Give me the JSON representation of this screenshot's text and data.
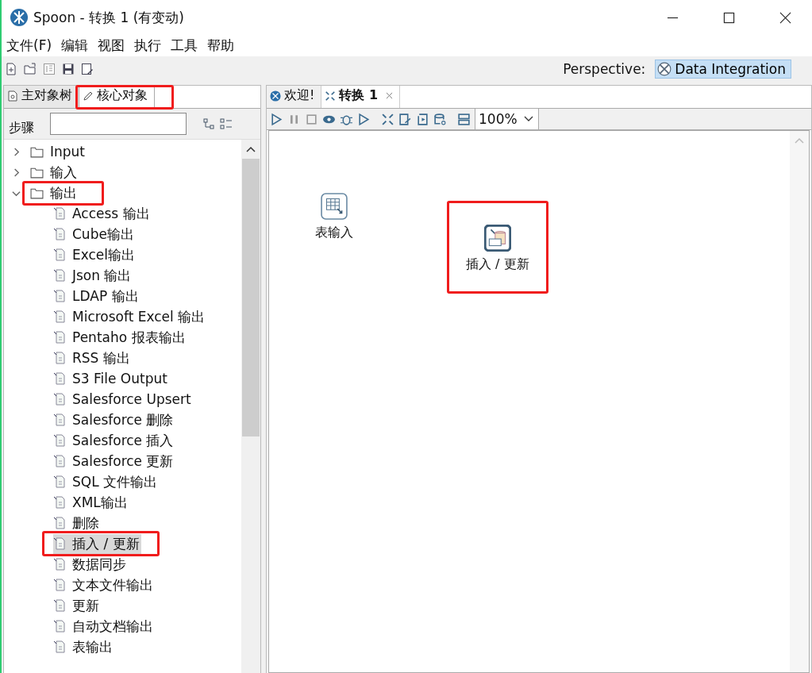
{
  "window": {
    "title": "Spoon - 转换 1 (有变动)"
  },
  "menu": [
    "文件(F)",
    "编辑",
    "视图",
    "执行",
    "工具",
    "帮助"
  ],
  "perspective": {
    "label": "Perspective:",
    "value": "Data Integration"
  },
  "left_tabs": [
    {
      "label": "主对象树",
      "selected": false,
      "annotated": false
    },
    {
      "label": "核心对象",
      "selected": true,
      "annotated": true
    }
  ],
  "steps": {
    "label": "步骤"
  },
  "tree": [
    {
      "label": "Input",
      "expanded": false,
      "annotated": false
    },
    {
      "label": "输入",
      "expanded": false,
      "annotated": false
    },
    {
      "label": "输出",
      "expanded": true,
      "annotated": true,
      "children": [
        {
          "label": "Access 输出",
          "selected": false,
          "annotated": false
        },
        {
          "label": "Cube输出",
          "selected": false,
          "annotated": false
        },
        {
          "label": "Excel输出",
          "selected": false,
          "annotated": false
        },
        {
          "label": "Json 输出",
          "selected": false,
          "annotated": false
        },
        {
          "label": "LDAP 输出",
          "selected": false,
          "annotated": false
        },
        {
          "label": "Microsoft Excel 输出",
          "selected": false,
          "annotated": false
        },
        {
          "label": "Pentaho 报表输出",
          "selected": false,
          "annotated": false
        },
        {
          "label": "RSS 输出",
          "selected": false,
          "annotated": false
        },
        {
          "label": "S3 File Output",
          "selected": false,
          "annotated": false
        },
        {
          "label": "Salesforce Upsert",
          "selected": false,
          "annotated": false
        },
        {
          "label": "Salesforce 删除",
          "selected": false,
          "annotated": false
        },
        {
          "label": "Salesforce 插入",
          "selected": false,
          "annotated": false
        },
        {
          "label": "Salesforce 更新",
          "selected": false,
          "annotated": false
        },
        {
          "label": "SQL 文件输出",
          "selected": false,
          "annotated": false
        },
        {
          "label": "XML输出",
          "selected": false,
          "annotated": false
        },
        {
          "label": "删除",
          "selected": false,
          "annotated": false
        },
        {
          "label": "插入 / 更新",
          "selected": true,
          "annotated": true
        },
        {
          "label": "数据同步",
          "selected": false,
          "annotated": false
        },
        {
          "label": "文本文件输出",
          "selected": false,
          "annotated": false
        },
        {
          "label": "更新",
          "selected": false,
          "annotated": false
        },
        {
          "label": "自动文档输出",
          "selected": false,
          "annotated": false
        },
        {
          "label": "表输出",
          "selected": false,
          "annotated": false
        }
      ]
    }
  ],
  "editor_tabs": [
    {
      "label": "欢迎!",
      "selected": false,
      "closable": false
    },
    {
      "label": "转换 1",
      "selected": true,
      "closable": true
    }
  ],
  "zoom": "100%",
  "canvas_steps": [
    {
      "label": "表输入",
      "annotated": false
    },
    {
      "label": "插入 / 更新",
      "annotated": true
    }
  ]
}
